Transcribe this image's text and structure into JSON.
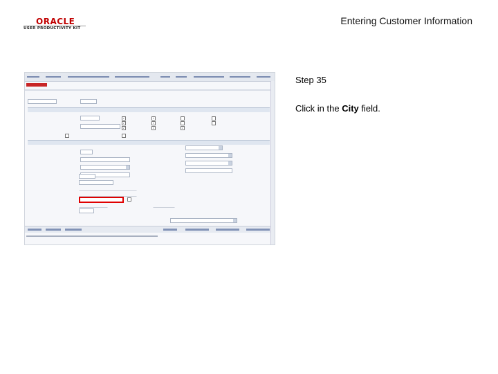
{
  "header": {
    "logo_top": "ORACLE",
    "logo_bottom": "USER PRODUCTIVITY KIT",
    "title": "Entering Customer Information"
  },
  "step": {
    "label": "Step 35",
    "instruction_prefix": "Click in the ",
    "instruction_field": "City",
    "instruction_suffix": " field."
  },
  "colors": {
    "logo_red": "#c00000",
    "highlight": "#e00000"
  }
}
